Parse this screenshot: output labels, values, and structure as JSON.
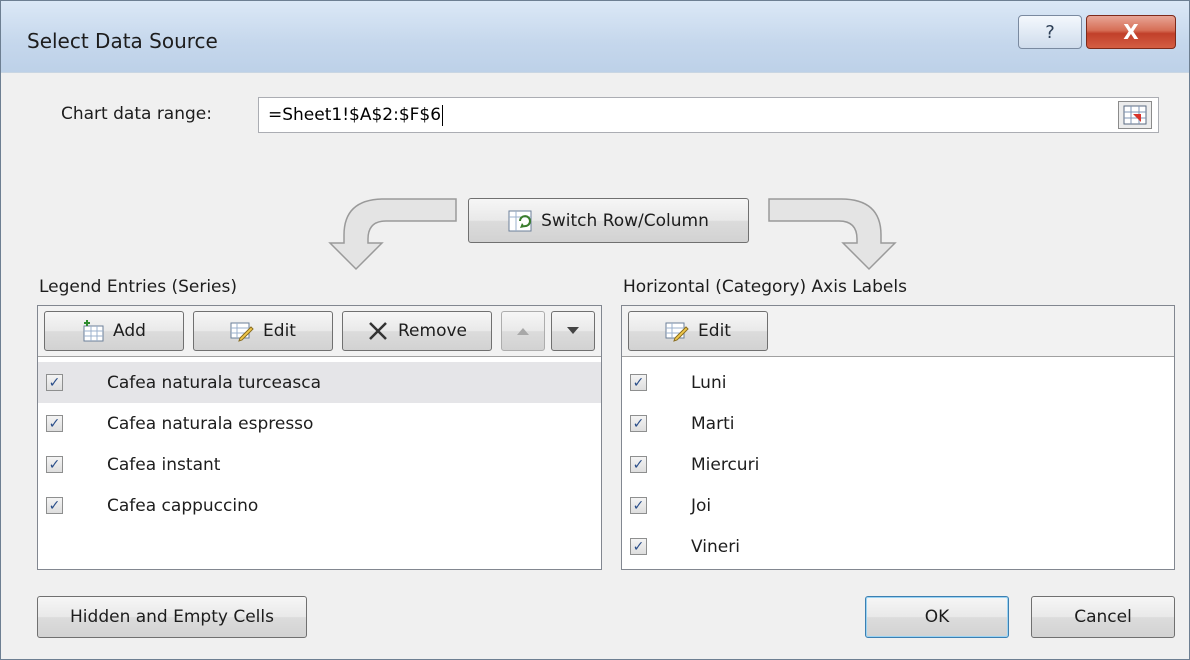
{
  "window": {
    "title": "Select Data Source",
    "help_glyph": "?",
    "close_glyph": "X"
  },
  "range": {
    "label": "Chart data range:",
    "value": "=Sheet1!$A$2:$F$6"
  },
  "switch_button": {
    "label": "Switch Row/Column"
  },
  "legend": {
    "header": "Legend Entries (Series)",
    "add_label": "Add",
    "edit_label": "Edit",
    "remove_label": "Remove",
    "items": [
      {
        "label": "Cafea naturala turceasca",
        "checked": true,
        "selected": true
      },
      {
        "label": "Cafea naturala espresso",
        "checked": true
      },
      {
        "label": "Cafea instant",
        "checked": true
      },
      {
        "label": "Cafea cappuccino",
        "checked": true
      }
    ]
  },
  "axis": {
    "header": "Horizontal (Category) Axis Labels",
    "edit_label": "Edit",
    "items": [
      {
        "label": "Luni",
        "checked": true
      },
      {
        "label": "Marti",
        "checked": true
      },
      {
        "label": "Miercuri",
        "checked": true
      },
      {
        "label": "Joi",
        "checked": true
      },
      {
        "label": "Vineri",
        "checked": true
      }
    ]
  },
  "footer": {
    "hidden_cells_label": "Hidden and Empty Cells",
    "ok_label": "OK",
    "cancel_label": "Cancel"
  },
  "colors": {
    "accent": "#2b4f8a",
    "titlebar": "#c5d7ec",
    "close": "#c1402a"
  },
  "icons": [
    "help-icon",
    "close-icon",
    "range-collapse-icon",
    "switch-icon",
    "add-icon",
    "edit-icon",
    "remove-icon",
    "up-arrow-icon",
    "down-arrow-icon",
    "checkbox-icon"
  ]
}
